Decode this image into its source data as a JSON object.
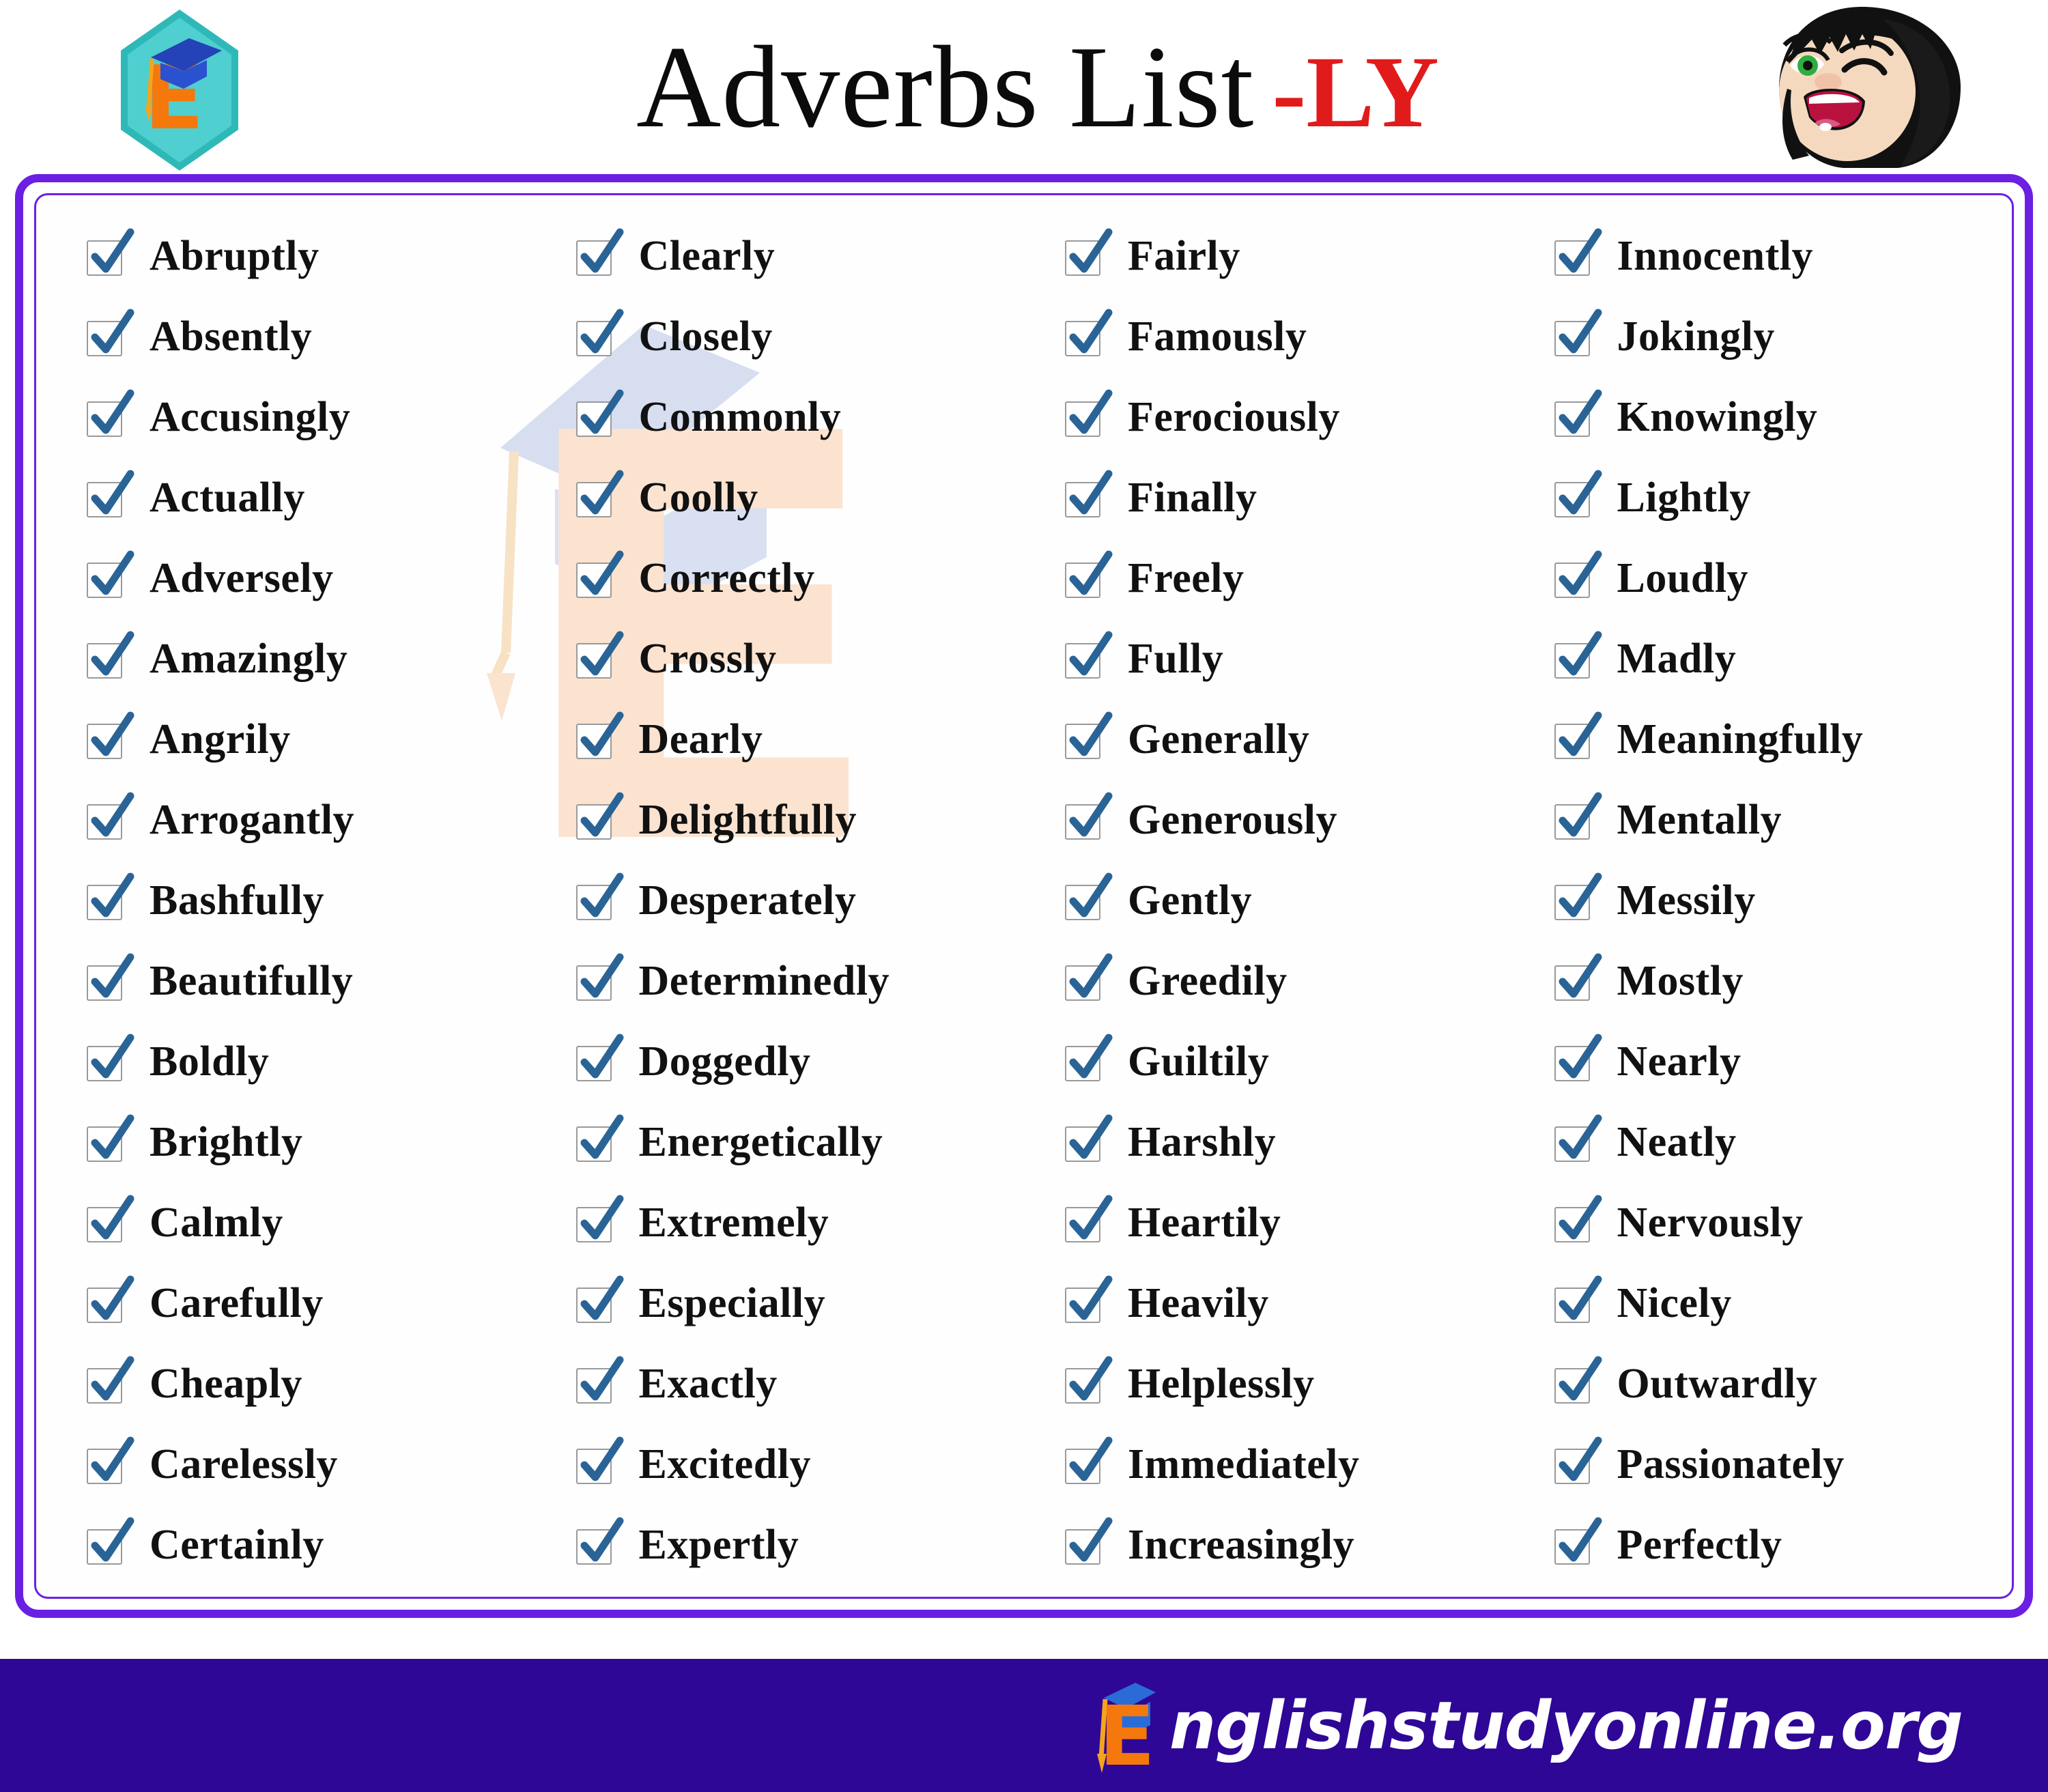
{
  "header": {
    "title_main": "Adverbs List",
    "title_suffix": "-LY",
    "logo_letter": "E",
    "logo_icon": "graduation-cap-badge",
    "avatar_icon": "winking-girl-face"
  },
  "colors": {
    "border_purple": "#6B1FE3",
    "footer_purple": "#2E0796",
    "suffix_red": "#E11B1B",
    "check_blue": "#2A6496",
    "logo_orange": "#F4780B",
    "logo_teal": "#2FB8B8",
    "logo_cap_blue": "#2443B8",
    "watermark_blue": "#D6DEF0",
    "watermark_peach": "#FBE3D0",
    "text_black": "#111111"
  },
  "list": {
    "columns": [
      {
        "id": "column-1",
        "items": [
          "Abruptly",
          "Absently",
          "Accusingly",
          "Actually",
          "Adversely",
          "Amazingly",
          "Angrily",
          "Arrogantly",
          "Bashfully",
          "Beautifully",
          "Boldly",
          "Brightly",
          "Calmly",
          "Carefully",
          "Cheaply",
          "Carelessly",
          "Certainly"
        ]
      },
      {
        "id": "column-2",
        "items": [
          "Clearly",
          "Closely",
          "Commonly",
          "Coolly",
          "Correctly",
          "Crossly",
          "Dearly",
          "Delightfully",
          "Desperately",
          "Determinedly",
          "Doggedly",
          "Energetically",
          "Extremely",
          "Especially",
          "Exactly",
          "Excitedly",
          "Expertly"
        ]
      },
      {
        "id": "column-3",
        "items": [
          "Fairly",
          "Famously",
          "Ferociously",
          "Finally",
          "Freely",
          "Fully",
          "Generally",
          "Generously",
          "Gently",
          "Greedily",
          "Guiltily",
          "Harshly",
          "Heartily",
          "Heavily",
          "Helplessly",
          "Immediately",
          "Increasingly"
        ]
      },
      {
        "id": "column-4",
        "items": [
          "Innocently",
          "Jokingly",
          "Knowingly",
          "Lightly",
          "Loudly",
          "Madly",
          "Meaningfully",
          "Mentally",
          "Messily",
          "Mostly",
          "Nearly",
          "Neatly",
          "Nervously",
          "Nicely",
          "Outwardly",
          "Passionately",
          "Perfectly"
        ]
      }
    ]
  },
  "footer": {
    "url": "nglishstudyonline.org",
    "logo_letter": "E",
    "full_url": "Englishstudyonline.org"
  }
}
